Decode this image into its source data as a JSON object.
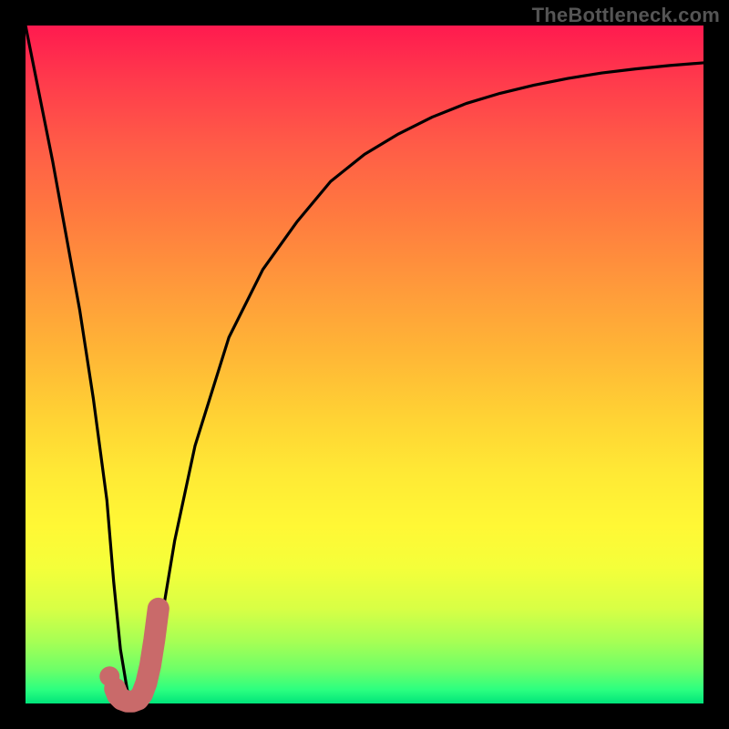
{
  "watermark": "TheBottleneck.com",
  "chart_data": {
    "type": "line",
    "title": "",
    "xlabel": "",
    "ylabel": "",
    "xlim": [
      0,
      100
    ],
    "ylim": [
      0,
      100
    ],
    "series": [
      {
        "name": "bottleneck-curve",
        "x": [
          0,
          4,
          8,
          10,
          12,
          13,
          14,
          15,
          16,
          17,
          18,
          19,
          20,
          22,
          25,
          30,
          35,
          40,
          45,
          50,
          55,
          60,
          65,
          70,
          75,
          80,
          85,
          90,
          95,
          100
        ],
        "values": [
          100,
          80,
          58,
          45,
          30,
          18,
          8,
          2,
          0,
          0,
          2,
          6,
          12,
          24,
          38,
          54,
          64,
          71,
          77,
          81,
          84,
          86.5,
          88.5,
          90,
          91.2,
          92.2,
          93,
          93.6,
          94.1,
          94.5
        ]
      }
    ],
    "marker": {
      "name": "j-marker",
      "color": "#c96a6a",
      "points_x": [
        13.2,
        13.6,
        14.2,
        15.0,
        15.8,
        16.6,
        17.2,
        17.8,
        18.4,
        19.0,
        19.6
      ],
      "points_y": [
        2.2,
        1.2,
        0.6,
        0.3,
        0.3,
        0.6,
        1.4,
        3.0,
        5.6,
        9.4,
        14.0
      ],
      "dot": {
        "x": 12.4,
        "y": 4.0
      }
    }
  }
}
